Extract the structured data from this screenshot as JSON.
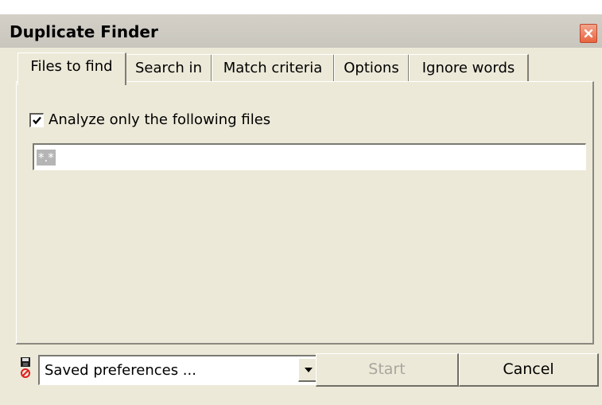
{
  "window": {
    "title": "Duplicate Finder"
  },
  "tabs": [
    {
      "label": "Files to find",
      "active": true
    },
    {
      "label": "Search in",
      "active": false
    },
    {
      "label": "Match criteria",
      "active": false
    },
    {
      "label": "Options",
      "active": false
    },
    {
      "label": "Ignore words",
      "active": false
    }
  ],
  "files_tab": {
    "analyze_only_checked": true,
    "analyze_only_label": "Analyze only the following files",
    "pattern_value": "*.*"
  },
  "footer": {
    "preferences_value": "Saved preferences ...",
    "start_label": "Start",
    "start_enabled": false,
    "cancel_label": "Cancel"
  },
  "icons": {
    "close": "close-icon",
    "check": "checkmark-icon",
    "dropdown": "chevron-down-icon",
    "preferences": "save-disk-icon"
  },
  "colors": {
    "window_bg": "#ece9d8",
    "close_button": "#e8643f",
    "disabled_text": "#a8a69e"
  }
}
